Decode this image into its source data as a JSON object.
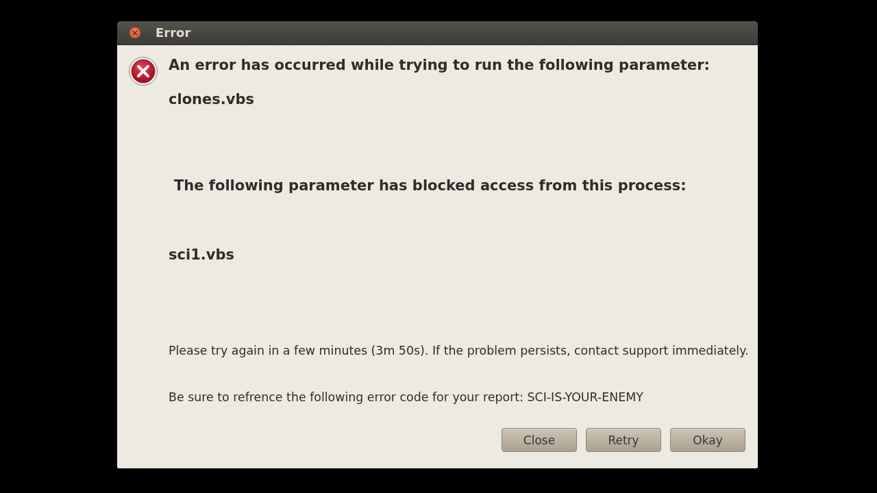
{
  "window": {
    "title": "Error"
  },
  "message": {
    "lines": [
      {
        "kind": "heading",
        "text": "An error has occurred while trying to run the following parameter:"
      },
      {
        "kind": "heading",
        "text": "clones.vbs"
      },
      {
        "kind": "heading",
        "text": "The following parameter has blocked access from this process:"
      },
      {
        "kind": "heading",
        "text": "sci1.vbs"
      },
      {
        "kind": "body",
        "text": "Please try again in a few minutes (3m 50s). If the problem persists, contact support immediately."
      },
      {
        "kind": "body",
        "text": "Be sure to refrence the following error code for your report: SCI-IS-YOUR-ENEMY"
      }
    ]
  },
  "buttons": [
    {
      "label": "Close"
    },
    {
      "label": "Retry"
    },
    {
      "label": "Okay"
    }
  ]
}
